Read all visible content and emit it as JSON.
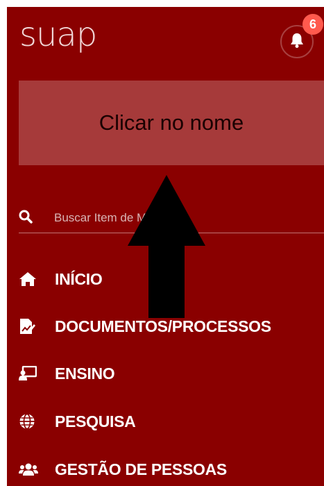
{
  "app": {
    "logo_text": "suap"
  },
  "notifications": {
    "count": "6"
  },
  "user_box": {
    "label": "Clicar no nome"
  },
  "search": {
    "placeholder": "Buscar Item de Menu"
  },
  "menu": {
    "items": [
      {
        "label": "INÍCIO",
        "icon": "home-icon"
      },
      {
        "label": "DOCUMENTOS/PROCESSOS",
        "icon": "document-chart-icon"
      },
      {
        "label": "ENSINO",
        "icon": "chalkboard-teacher-icon"
      },
      {
        "label": "PESQUISA",
        "icon": "globe-icon"
      },
      {
        "label": "GESTÃO DE PESSOAS",
        "icon": "users-icon"
      }
    ]
  },
  "colors": {
    "sidebar_bg": "#8a0000",
    "user_box_bg": "#a63a3a",
    "badge_bg": "#ff5a4e",
    "annotation_arrow": "#000000"
  }
}
